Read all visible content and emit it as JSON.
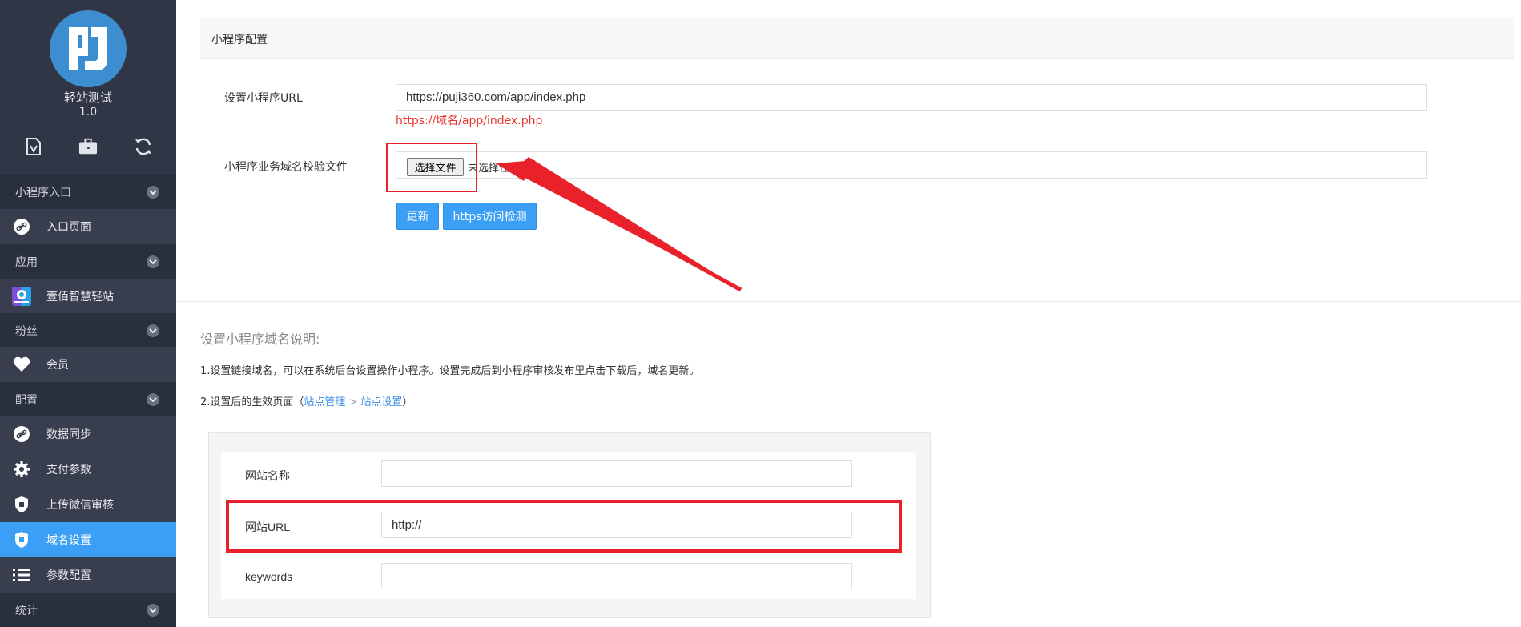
{
  "sidebar": {
    "site_name": "轻站测试",
    "version": "1.0",
    "toolbar_icons": [
      "document-v-icon",
      "briefcase-icon",
      "refresh-icon"
    ],
    "groups": [
      {
        "label": "小程序入口",
        "items": [
          {
            "label": "入口页面",
            "icon": "link-icon"
          }
        ]
      },
      {
        "label": "应用",
        "items": [
          {
            "label": "壹佰智慧轻站",
            "icon": "app-logo-icon"
          }
        ]
      },
      {
        "label": "粉丝",
        "items": [
          {
            "label": "会员",
            "icon": "heart-icon"
          }
        ]
      },
      {
        "label": "配置",
        "items": [
          {
            "label": "数据同步",
            "icon": "link-icon"
          },
          {
            "label": "支付参数",
            "icon": "gear-icon"
          },
          {
            "label": "上传微信审核",
            "icon": "shield-icon"
          },
          {
            "label": "域名设置",
            "icon": "shield-icon",
            "active": true
          },
          {
            "label": "参数配置",
            "icon": "list-icon"
          }
        ]
      },
      {
        "label": "统计",
        "items": []
      }
    ]
  },
  "panel": {
    "title": "小程序配置",
    "url_label": "设置小程序URL",
    "url_value": "https://puji360.com/app/index.php",
    "url_hint": "https://域名/app/index.php",
    "file_label": "小程序业务域名校验文件",
    "file_button": "选择文件",
    "file_status": "未选择任何文件",
    "update_button": "更新",
    "https_check_button": "https访问检测"
  },
  "notes": {
    "title": "设置小程序域名说明:",
    "line1": "1.设置链接域名，可以在系统后台设置操作小程序。设置完成后到小程序审核发布里点击下载后，域名更新。",
    "line2_prefix": "2.设置后的生效页面（",
    "crumb1": "站点管理",
    "crumb_sep": ">",
    "crumb2": "站点设置",
    "line2_suffix": "）"
  },
  "example_form": {
    "site_name_label": "网站名称",
    "site_name_value": "",
    "site_url_label": "网站URL",
    "site_url_value": "http://",
    "keywords_label": "keywords",
    "keywords_value": ""
  },
  "colors": {
    "sidebar_bg": "#303645",
    "accent_blue": "#3a9ff5",
    "annotation_red": "#e8212a",
    "hint_red": "#e8322d"
  }
}
